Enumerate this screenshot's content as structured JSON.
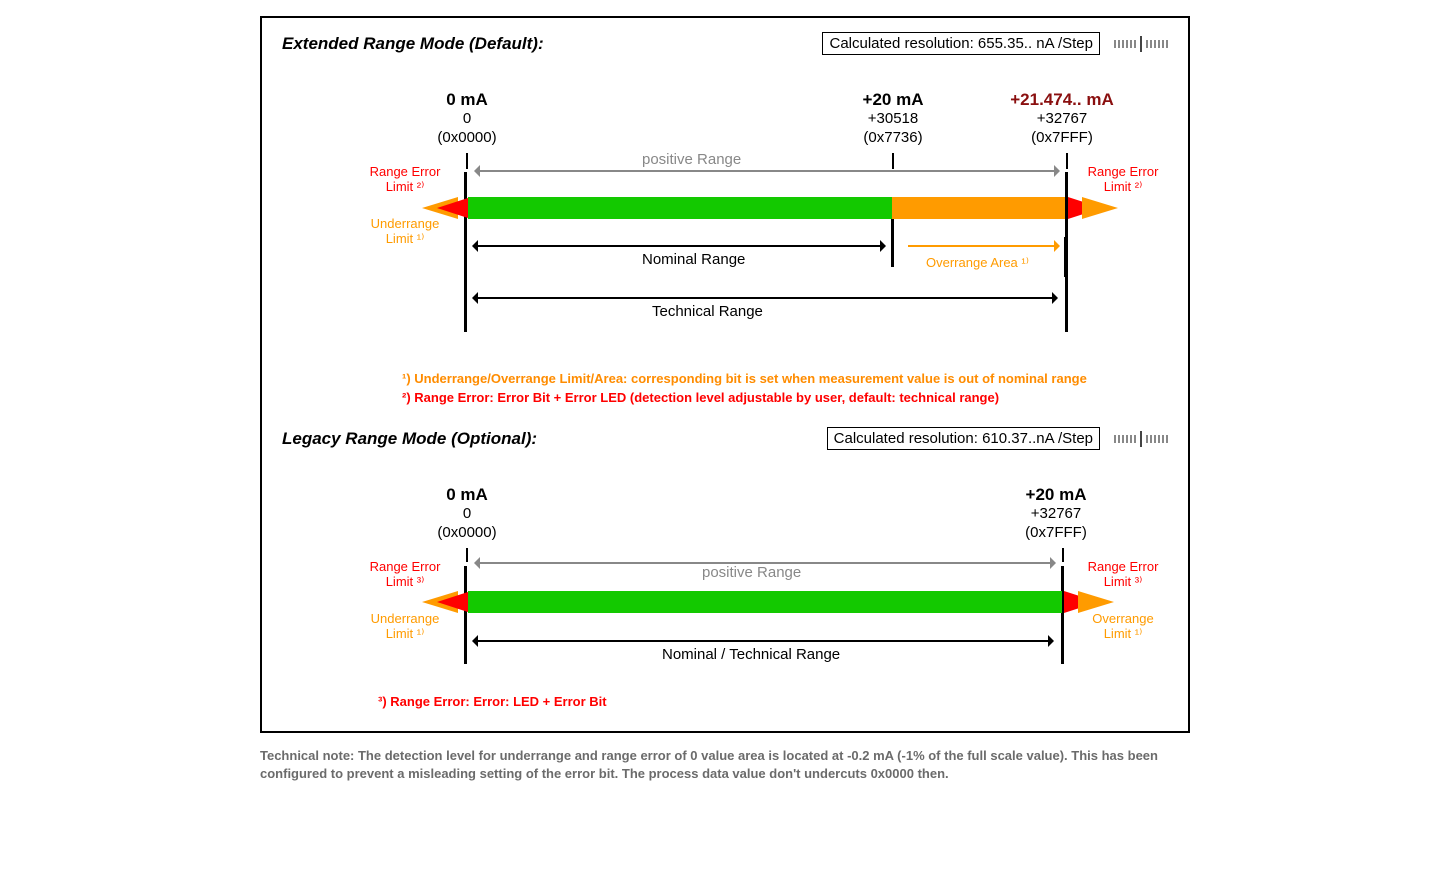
{
  "extended": {
    "title": "Extended Range Mode (Default):",
    "resolution": "Calculated resolution: 655.35.. nA /Step",
    "zero": {
      "ma": "0 mA",
      "dec": "0",
      "hex": "(0x0000)"
    },
    "twenty": {
      "ma": "+20 mA",
      "dec": "+30518",
      "hex": "(0x7736)"
    },
    "max": {
      "ma": "+21.474.. mA",
      "dec": "+32767",
      "hex": "(0x7FFF)"
    },
    "posrange": "positive Range",
    "range_error": "Range Error",
    "limit2": "Limit ²⁾",
    "underrange": "Underrange",
    "limit1": "Limit ¹⁾",
    "nominal": "Nominal Range",
    "overrange": "Overrange Area ¹⁾",
    "technical": "Technical Range"
  },
  "legacy": {
    "title": "Legacy Range Mode (Optional):",
    "resolution": "Calculated resolution: 610.37..nA /Step",
    "zero": {
      "ma": "0 mA",
      "dec": "0",
      "hex": "(0x0000)"
    },
    "max": {
      "ma": "+20 mA",
      "dec": "+32767",
      "hex": "(0x7FFF)"
    },
    "posrange": "positive Range",
    "range_error": "Range Error",
    "limit3": "Limit ³⁾",
    "underrange": "Underrange",
    "limit1": "Limit ¹⁾",
    "overrange": "Overrange",
    "nominal_tech": "Nominal / Technical Range"
  },
  "footnotes": {
    "f1": "¹) Underrange/Overrange Limit/Area: corresponding bit is set when measurement value is out of nominal range",
    "f2": "²) Range Error: Error Bit + Error LED (detection level adjustable by user, default: technical range)",
    "f3": "³) Range Error: Error: LED + Error Bit"
  },
  "technote": "Technical note: The detection level for underrange and range error of 0 value area is located at -0.2 mA (-1% of the full scale value). This has been configured to prevent a misleading setting of the error bit. The process data value don't undercuts 0x0000 then."
}
